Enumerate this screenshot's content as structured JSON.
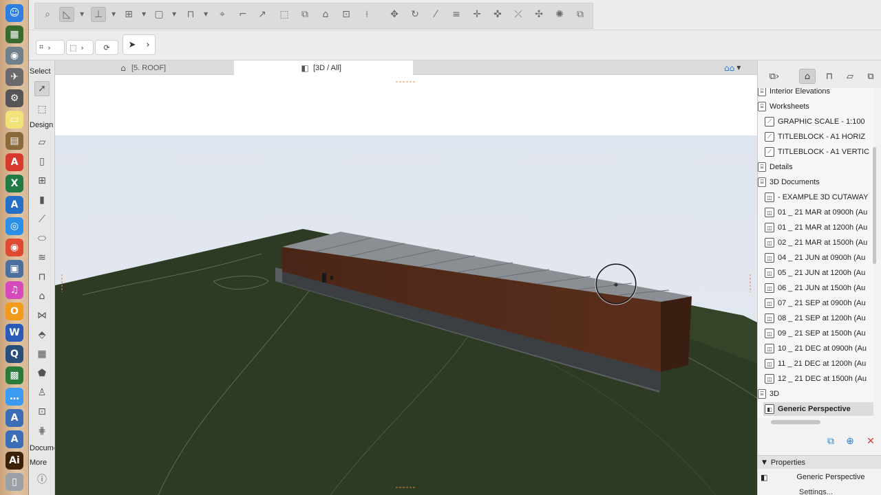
{
  "dock": {
    "icons": [
      {
        "name": "finder-icon",
        "color": "#2f7fe0",
        "glyph": "☺"
      },
      {
        "name": "calendar-icon",
        "color": "#3a6b2e",
        "glyph": "▦"
      },
      {
        "name": "photos-icon",
        "color": "#6f7f8c",
        "glyph": "◉"
      },
      {
        "name": "launchpad-icon",
        "color": "#6a6a6a",
        "glyph": "✈"
      },
      {
        "name": "system-preferences-icon",
        "color": "#555555",
        "glyph": "⚙"
      },
      {
        "name": "notes-icon",
        "color": "#f2e27a",
        "glyph": "▭"
      },
      {
        "name": "archive-icon",
        "color": "#8a6a3a",
        "glyph": "▤"
      },
      {
        "name": "acrobat-icon",
        "color": "#d83b2b",
        "glyph": "A"
      },
      {
        "name": "excel-icon",
        "color": "#1f7a44",
        "glyph": "X"
      },
      {
        "name": "archicad-icon",
        "color": "#2570c7",
        "glyph": "A"
      },
      {
        "name": "safari-icon",
        "color": "#2b8fe8",
        "glyph": "◎"
      },
      {
        "name": "chrome-icon",
        "color": "#e04a32",
        "glyph": "◉"
      },
      {
        "name": "ipad-sync-icon",
        "color": "#4c6fa0",
        "glyph": "▣"
      },
      {
        "name": "itunes-icon",
        "color": "#d64abc",
        "glyph": "♫"
      },
      {
        "name": "vlc-icon",
        "color": "#f29a1a",
        "glyph": "O"
      },
      {
        "name": "word-icon",
        "color": "#2b5bb8",
        "glyph": "W"
      },
      {
        "name": "quicktime-icon",
        "color": "#2a4e7a",
        "glyph": "Q"
      },
      {
        "name": "scanner-icon",
        "color": "#2a7a3a",
        "glyph": "▩"
      },
      {
        "name": "messages-icon",
        "color": "#3b9af2",
        "glyph": "…"
      },
      {
        "name": "archicad-alt-icon",
        "color": "#3b6db8",
        "glyph": "A"
      },
      {
        "name": "archicad-second-icon",
        "color": "#3b6db8",
        "glyph": "A"
      },
      {
        "name": "illustrator-icon",
        "color": "#3a2108",
        "glyph": "Ai"
      },
      {
        "name": "trash-icon",
        "color": "#9aa0a6",
        "glyph": "▯"
      }
    ]
  },
  "tabs": [
    {
      "label": "[5. ROOF]",
      "icon": "floor-plan-icon"
    },
    {
      "label": "[3D / All]",
      "icon": "3d-view-icon"
    }
  ],
  "toolbox": {
    "select_label": "Select",
    "design_label": "Design",
    "document_label": "Document",
    "more_label": "More"
  },
  "navigator": {
    "items": [
      {
        "label": "Interior Elevations",
        "indent": 0,
        "icon": "folder-icon"
      },
      {
        "label": "Worksheets",
        "indent": 0,
        "icon": "folder-icon"
      },
      {
        "label": "GRAPHIC SCALE - 1:100",
        "indent": 1,
        "icon": "worksheet-icon"
      },
      {
        "label": "TITLEBLOCK - A1 HORIZ",
        "indent": 1,
        "icon": "worksheet-icon"
      },
      {
        "label": "TITLEBLOCK - A1 VERTIC",
        "indent": 1,
        "icon": "worksheet-icon"
      },
      {
        "label": "Details",
        "indent": 0,
        "icon": "folder-icon"
      },
      {
        "label": "3D Documents",
        "indent": 0,
        "icon": "folder-icon"
      },
      {
        "label": "- EXAMPLE 3D CUTAWAY",
        "indent": 1,
        "icon": "3d-document-icon"
      },
      {
        "label": "01 _ 21 MAR at 0900h (Au",
        "indent": 1,
        "icon": "3d-document-icon"
      },
      {
        "label": "01 _ 21 MAR at 1200h (Au",
        "indent": 1,
        "icon": "3d-document-icon"
      },
      {
        "label": "02 _ 21 MAR at 1500h (Au",
        "indent": 1,
        "icon": "3d-document-icon"
      },
      {
        "label": "04 _ 21 JUN at 0900h (Au",
        "indent": 1,
        "icon": "3d-document-icon"
      },
      {
        "label": "05 _ 21 JUN at 1200h (Au",
        "indent": 1,
        "icon": "3d-document-icon"
      },
      {
        "label": "06 _ 21 JUN at 1500h (Au",
        "indent": 1,
        "icon": "3d-document-icon"
      },
      {
        "label": "07 _ 21 SEP at 0900h (Au",
        "indent": 1,
        "icon": "3d-document-icon"
      },
      {
        "label": "08 _ 21 SEP at 1200h (Au",
        "indent": 1,
        "icon": "3d-document-icon"
      },
      {
        "label": "09 _ 21 SEP at 1500h (Au",
        "indent": 1,
        "icon": "3d-document-icon"
      },
      {
        "label": "10 _ 21 DEC at 0900h (Au",
        "indent": 1,
        "icon": "3d-document-icon"
      },
      {
        "label": "11 _ 21 DEC at 1200h (Au",
        "indent": 1,
        "icon": "3d-document-icon"
      },
      {
        "label": "12 _ 21 DEC at 1500h (Au",
        "indent": 1,
        "icon": "3d-document-icon"
      },
      {
        "label": "3D",
        "indent": 0,
        "icon": "folder-icon"
      },
      {
        "label": "Generic Perspective",
        "indent": 1,
        "icon": "perspective-icon",
        "selected": true
      }
    ]
  },
  "properties": {
    "header": "Properties",
    "view_name": "Generic Perspective",
    "settings_label": "Settings..."
  },
  "colors": {
    "sky": "#dde3ec",
    "ground": "#2c3a24",
    "roof": "#8a8e92",
    "facade": "#4a2a1c"
  }
}
